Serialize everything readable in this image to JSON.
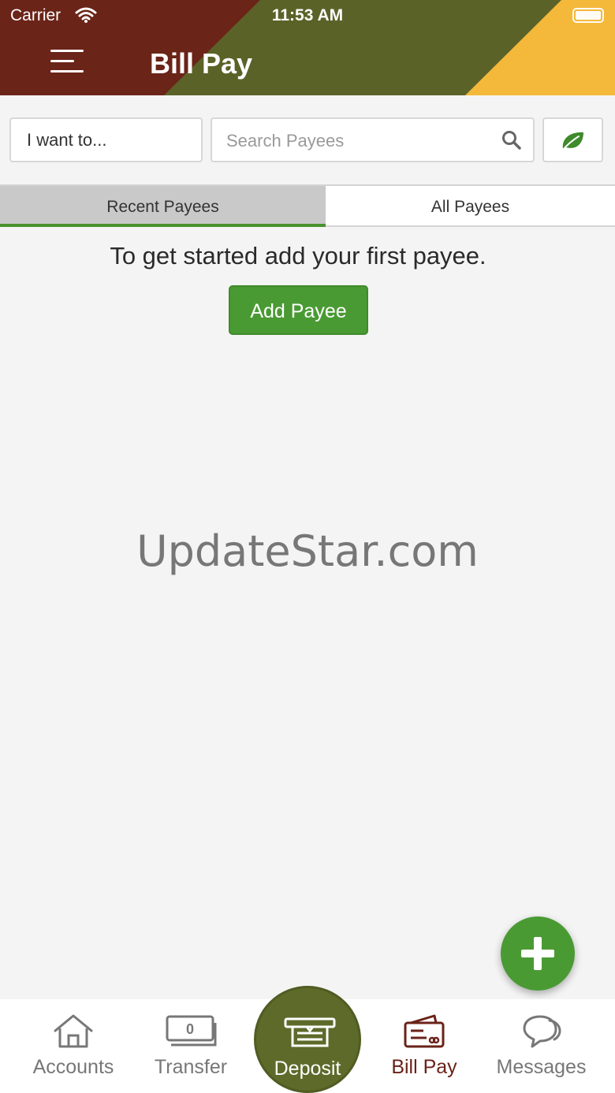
{
  "status_bar": {
    "carrier": "Carrier",
    "time": "11:53 AM"
  },
  "header": {
    "title": "Bill Pay",
    "colors": {
      "left": "#6b2418",
      "middle": "#5b6228",
      "right": "#f4b83a"
    }
  },
  "toolbar": {
    "action_select": "I want to...",
    "search_placeholder": "Search Payees",
    "search_icon": "search-icon",
    "leaf_icon": "leaf-icon"
  },
  "tabs": [
    {
      "label": "Recent Payees",
      "active": true
    },
    {
      "label": "All Payees",
      "active": false
    }
  ],
  "main": {
    "empty_message": "To get started add your first payee.",
    "add_payee_label": "Add Payee",
    "watermark": "UpdateStar.com"
  },
  "fab": {
    "icon": "plus-icon",
    "color": "#4a9a34"
  },
  "bottom_nav": {
    "accounts": {
      "label": "Accounts",
      "icon": "home-icon"
    },
    "transfer": {
      "label": "Transfer",
      "icon": "cash-icon"
    },
    "deposit": {
      "label": "Deposit",
      "icon": "atm-icon"
    },
    "bill_pay": {
      "label": "Bill Pay",
      "icon": "wallet-card-icon",
      "active": true
    },
    "messages": {
      "label": "Messages",
      "icon": "chat-bubbles-icon"
    }
  }
}
